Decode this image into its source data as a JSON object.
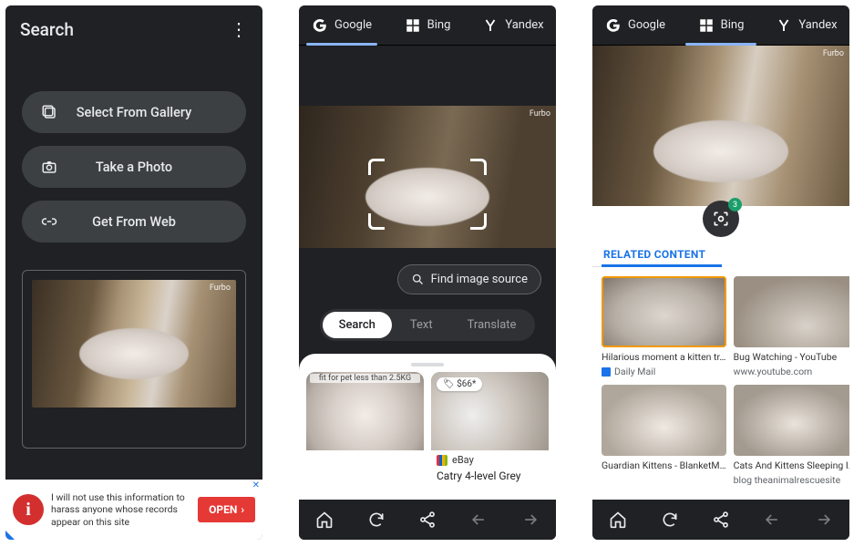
{
  "screen1": {
    "title": "Search",
    "buttons": {
      "gallery": "Select From Gallery",
      "camera": "Take a Photo",
      "web": "Get From Web"
    },
    "preview_watermark": "Furbo",
    "ad": {
      "text": "I will not use this information to harass anyone whose records appear on this site",
      "cta": "OPEN"
    }
  },
  "engines": {
    "google": "Google",
    "bing": "Bing",
    "yandex": "Yandex"
  },
  "screen2": {
    "find_source": "Find image source",
    "modes": {
      "search": "Search",
      "text": "Text",
      "translate": "Translate"
    },
    "results": {
      "card1_caption": "fit for pet less than 2.5KG",
      "card2_price": "$66*",
      "card2_source": "eBay",
      "card2_title": "Catry 4-level Grey"
    },
    "watermark": "Furbo"
  },
  "screen3": {
    "watermark": "Furbo",
    "lens_badge": "3",
    "related_header": "RELATED CONTENT",
    "items": [
      {
        "title": "Hilarious moment a kitten tr…",
        "source": "Daily Mail"
      },
      {
        "title": "Bug Watching - YouTube",
        "source": "www.youtube.com"
      },
      {
        "title": "Guardian Kittens - BlanketM…",
        "source": ""
      },
      {
        "title": "Cats And Kittens Sleeping I…",
        "source": "blog theanimalrescuesite"
      }
    ]
  }
}
